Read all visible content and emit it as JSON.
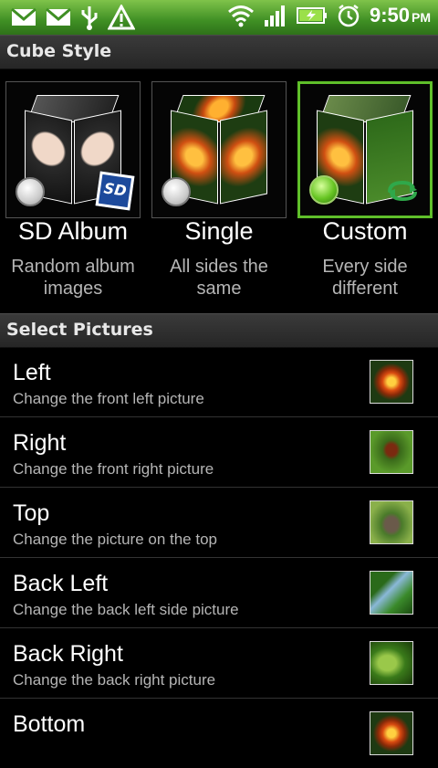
{
  "status_bar": {
    "time": "9:50",
    "ampm": "PM",
    "left_icons": [
      "mail-icon",
      "mail-icon",
      "usb-icon",
      "warning-icon"
    ],
    "right_icons": [
      "wifi-icon",
      "signal-icon",
      "battery-icon",
      "alarm-icon"
    ]
  },
  "header": {
    "title": "Cube Style"
  },
  "styles": [
    {
      "title": "SD Album",
      "subtitle_line1": "Random album",
      "subtitle_line2": "images",
      "selected": false,
      "badge": "SD"
    },
    {
      "title": "Single",
      "subtitle_line1": "All sides the",
      "subtitle_line2": "same",
      "selected": false
    },
    {
      "title": "Custom",
      "subtitle_line1": "Every side",
      "subtitle_line2": "different",
      "selected": true
    }
  ],
  "select_section": {
    "title": "Select Pictures"
  },
  "pictures": [
    {
      "title": "Left",
      "subtitle": "Change the front left picture",
      "thumb": "flower"
    },
    {
      "title": "Right",
      "subtitle": "Change the front right picture",
      "thumb": "butterfly"
    },
    {
      "title": "Top",
      "subtitle": "Change the picture on the top",
      "thumb": "butterfly-leaf"
    },
    {
      "title": "Back Left",
      "subtitle": "Change the back left side picture",
      "thumb": "palm"
    },
    {
      "title": "Back Right",
      "subtitle": "Change the back right picture",
      "thumb": "leaves"
    },
    {
      "title": "Bottom",
      "subtitle": "",
      "thumb": "flower"
    }
  ],
  "colors": {
    "accent": "#5fbf2a",
    "status_bar": "#3f8f24",
    "section": "#2f2f2f",
    "subtext": "#b5b5b5"
  }
}
